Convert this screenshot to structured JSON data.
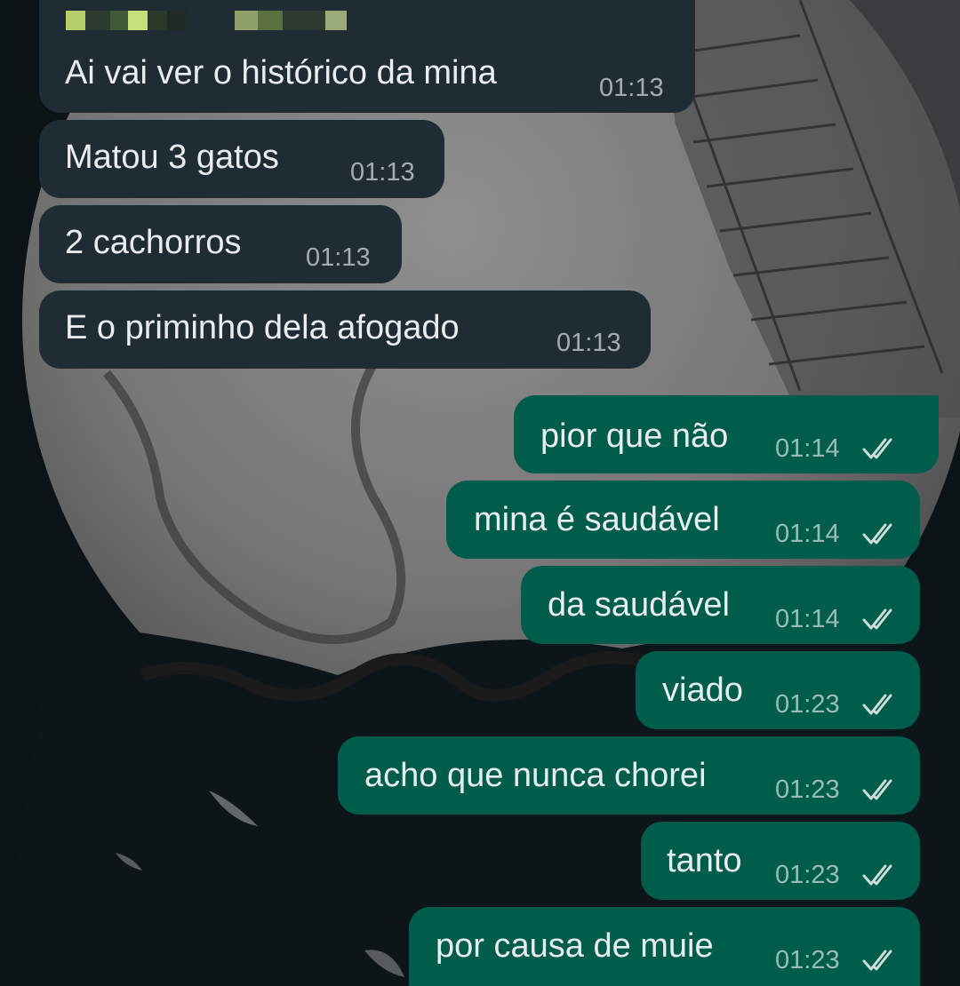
{
  "chat": {
    "incoming_messages": [
      {
        "text": "Ai vai ver o histórico da mina",
        "time": "01:13"
      },
      {
        "text": "Matou 3 gatos",
        "time": "01:13"
      },
      {
        "text": "2 cachorros",
        "time": "01:13"
      },
      {
        "text": "E o priminho dela afogado",
        "time": "01:13"
      }
    ],
    "outgoing_messages": [
      {
        "text": "pior que não",
        "time": "01:14",
        "status": "read-double-check-icon"
      },
      {
        "text": "mina é saudável",
        "time": "01:14",
        "status": "read-double-check-icon"
      },
      {
        "text": "da saudável",
        "time": "01:14",
        "status": "read-double-check-icon"
      },
      {
        "text": "viado",
        "time": "01:23",
        "status": "read-double-check-icon"
      },
      {
        "text": "acho que nunca chorei",
        "time": "01:23",
        "status": "read-double-check-icon"
      },
      {
        "text": "tanto",
        "time": "01:23",
        "status": "read-double-check-icon"
      },
      {
        "text": "por causa de muie",
        "time": "01:23",
        "status": "read-double-check-icon"
      }
    ]
  },
  "colors": {
    "incoming_bubble": "#1f2c34",
    "outgoing_bubble": "#005c4b",
    "text": "#e9edef",
    "background": "#0b1317"
  }
}
